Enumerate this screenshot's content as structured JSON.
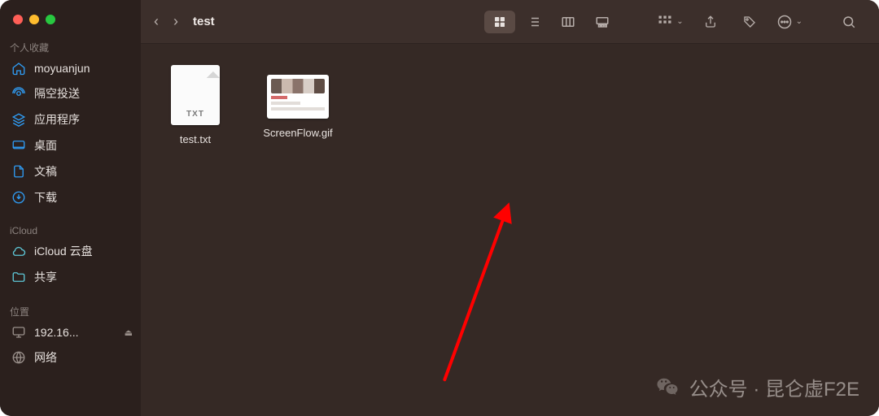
{
  "window": {
    "title": "test"
  },
  "sidebar": {
    "sections": [
      {
        "label": "个人收藏",
        "items": [
          {
            "icon": "home",
            "label": "moyuanjun"
          },
          {
            "icon": "airdrop",
            "label": "隔空投送"
          },
          {
            "icon": "apps",
            "label": "应用程序"
          },
          {
            "icon": "desktop",
            "label": "桌面"
          },
          {
            "icon": "doc",
            "label": "文稿"
          },
          {
            "icon": "download",
            "label": "下载"
          }
        ]
      },
      {
        "label": "iCloud",
        "items": [
          {
            "icon": "cloud",
            "label": "iCloud 云盘"
          },
          {
            "icon": "share",
            "label": "共享"
          }
        ]
      },
      {
        "label": "位置",
        "items": [
          {
            "icon": "monitor",
            "label": "192.16...",
            "eject": true
          },
          {
            "icon": "globe",
            "label": "网络"
          }
        ]
      }
    ]
  },
  "toolbar": {
    "back": "‹",
    "fwd": "›"
  },
  "files": [
    {
      "name": "test.txt",
      "kind": "txt",
      "badge": "TXT"
    },
    {
      "name": "ScreenFlow.gif",
      "kind": "gif"
    }
  ],
  "watermark": {
    "text": "公众号 · 昆仑虚F2E"
  }
}
